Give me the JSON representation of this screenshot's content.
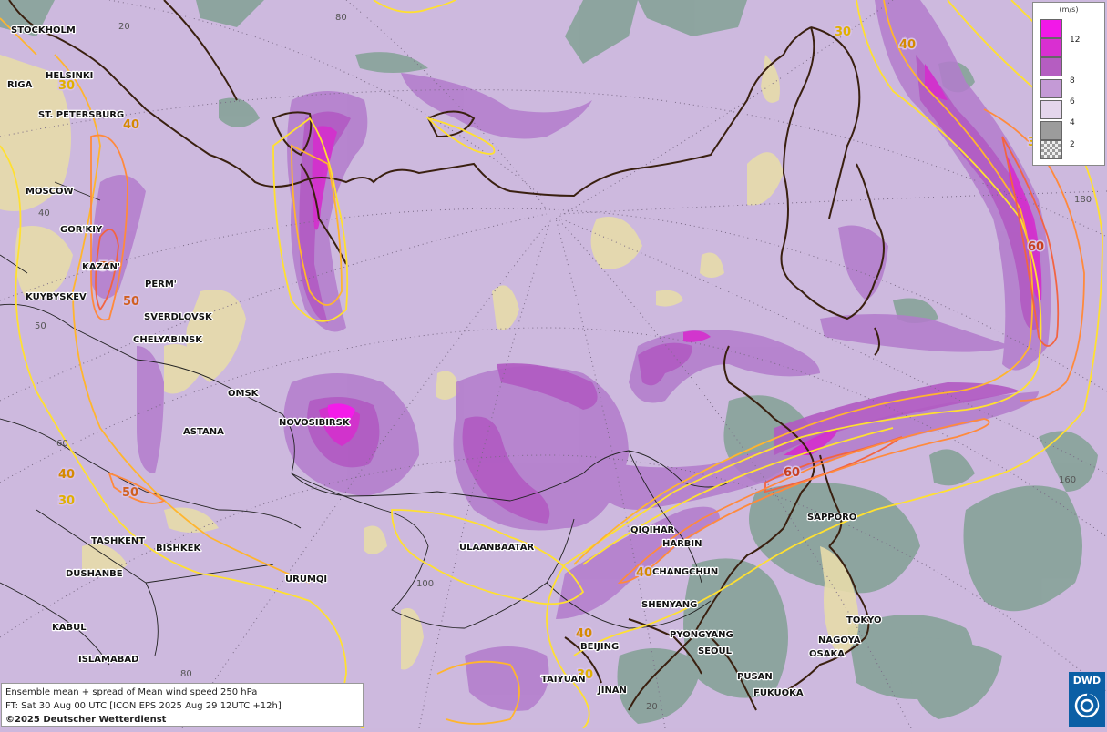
{
  "legend": {
    "unit": "(m/s)",
    "levels": [
      {
        "label": "12",
        "color": "#f218e8"
      },
      {
        "label": "8",
        "color": "#d92fd1"
      },
      {
        "label": "6",
        "color": "#b55dc1"
      },
      {
        "label": "4",
        "color": "#c49ad6"
      },
      {
        "label": "2",
        "color": "#e4d6ec"
      },
      {
        "label": "",
        "color": "#9c9c9c"
      }
    ]
  },
  "caption": {
    "line1": "Ensemble mean + spread of Mean wind speed 250 hPa",
    "line2": "FT: Sat 30 Aug 00 UTC [ICON EPS 2025 Aug 29 12UTC +12h]",
    "line3": "©2025 Deutscher Wetterdienst"
  },
  "logo": {
    "text": "DWD"
  },
  "cities": [
    "STOCKHOLM",
    "HELSINKI",
    "RIGA",
    "ST. PETERSBURG",
    "MOSCOW",
    "GOR'KIY",
    "KAZAN'",
    "KUYBYSKEV",
    "PERM'",
    "SVERDLOVSK",
    "CHELYABINSK",
    "OMSK",
    "NOVOSIBIRSK",
    "ASTANA",
    "TASHKENT",
    "BISHKEK",
    "DUSHANBE",
    "URUMQI",
    "KABUL",
    "ISLAMABAD",
    "ULAANBAATAR",
    "QIQIHAR",
    "HARBIN",
    "CHANGCHUN",
    "SHENYANG",
    "BEIJING",
    "TAIYUAN",
    "JINAN",
    "PYONGYANG",
    "SEOUL",
    "PUSAN",
    "FUKUOKA",
    "SAPPORO",
    "TOKYO",
    "NAGOYA",
    "OSAKA"
  ],
  "grid_labels": [
    "20",
    "80",
    "40",
    "50",
    "60",
    "100",
    "80",
    "160",
    "180",
    "20"
  ],
  "contour_labels": [
    "30",
    "30",
    "40",
    "40",
    "30",
    "50",
    "50",
    "40",
    "30",
    "60",
    "60",
    "50",
    "40",
    "30",
    "40"
  ],
  "colors": {
    "c30": "#ffe030",
    "c40": "#ffb52e",
    "c50": "#ff8a3c",
    "c60": "#f26442",
    "coast": "#3a2010",
    "border": "#222222"
  }
}
